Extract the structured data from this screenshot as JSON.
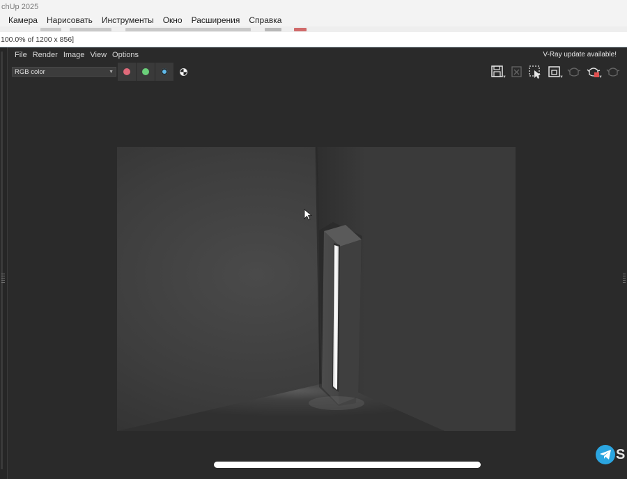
{
  "host": {
    "title": "chUp 2025",
    "menu": [
      "Камера",
      "Нарисовать",
      "Инструменты",
      "Окно",
      "Расширения",
      "Справка"
    ]
  },
  "vfb": {
    "title": "100.0% of 1200 x 856]",
    "menu": [
      "File",
      "Render",
      "Image",
      "View",
      "Options"
    ],
    "update_notice": "V-Ray update available!",
    "channel": "RGB color",
    "channel_buttons": [
      {
        "name": "red-channel",
        "color": "#e06a7a"
      },
      {
        "name": "green-channel",
        "color": "#6bd07a"
      },
      {
        "name": "blue-channel",
        "color": "#5fb8e8"
      },
      {
        "name": "monochrome",
        "color": "#dddddd"
      }
    ],
    "toolbar_icons": [
      "save-icon",
      "clear-image-icon",
      "region-render-icon",
      "track-mouse-icon",
      "render-teapot-icon",
      "stop-render-teapot-icon",
      "interactive-teapot-icon"
    ]
  },
  "overlay": {
    "badge_letter": "S"
  }
}
